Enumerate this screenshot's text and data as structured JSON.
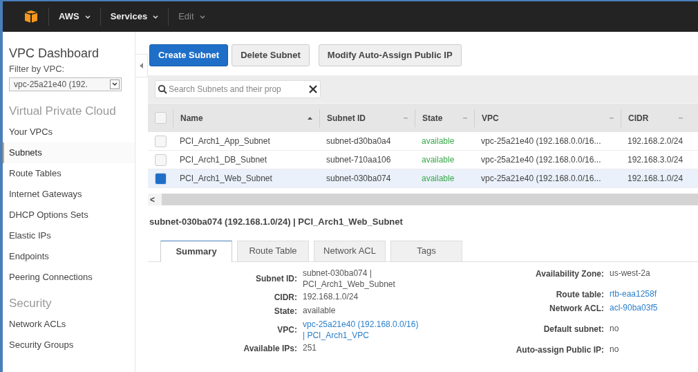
{
  "top_nav": [
    {
      "label": "AWS",
      "muted": false
    },
    {
      "label": "Services",
      "muted": false
    },
    {
      "label": "Edit",
      "muted": true
    }
  ],
  "sidebar": {
    "title": "VPC Dashboard",
    "filter_label": "Filter by VPC:",
    "filter_value": "vpc-25a21e40 (192.",
    "items": [
      {
        "kind": "section",
        "label": "Virtual Private Cloud"
      },
      {
        "kind": "link",
        "label": "Your VPCs",
        "selected": false
      },
      {
        "kind": "link",
        "label": "Subnets",
        "selected": true
      },
      {
        "kind": "link",
        "label": "Route Tables",
        "selected": false
      },
      {
        "kind": "link",
        "label": "Internet Gateways",
        "selected": false
      },
      {
        "kind": "link",
        "label": "DHCP Options Sets",
        "selected": false
      },
      {
        "kind": "link",
        "label": "Elastic IPs",
        "selected": false
      },
      {
        "kind": "link",
        "label": "Endpoints",
        "selected": false
      },
      {
        "kind": "link",
        "label": "Peering Connections",
        "selected": false
      },
      {
        "kind": "section",
        "label": "Security"
      },
      {
        "kind": "link",
        "label": "Network ACLs",
        "selected": false
      },
      {
        "kind": "link",
        "label": "Security Groups",
        "selected": false
      }
    ]
  },
  "toolbar": [
    {
      "label": "Create Subnet",
      "primary": true
    },
    {
      "label": "Delete Subnet",
      "primary": false
    },
    {
      "label": "Modify Auto-Assign Public IP",
      "primary": false
    }
  ],
  "search": {
    "placeholder": "Search Subnets and their prop"
  },
  "table": {
    "select_all": {
      "checked": false
    },
    "columns": [
      {
        "label": "Name",
        "sorted": true
      },
      {
        "label": "Subnet ID",
        "sorted": false
      },
      {
        "label": "State",
        "sorted": false
      },
      {
        "label": "VPC",
        "sorted": false
      },
      {
        "label": "CIDR",
        "sorted": false
      }
    ],
    "rows": [
      {
        "selected": false,
        "cells": [
          "PCI_Arch1_App_Subnet",
          "subnet-d30ba0a4",
          "available",
          "vpc-25a21e40 (192.168.0.0/16...",
          "192.168.2.0/24"
        ]
      },
      {
        "selected": false,
        "cells": [
          "PCI_Arch1_DB_Subnet",
          "subnet-710aa106",
          "available",
          "vpc-25a21e40 (192.168.0.0/16...",
          "192.168.3.0/24"
        ]
      },
      {
        "selected": true,
        "cells": [
          "PCI_Arch1_Web_Subnet",
          "subnet-030ba074",
          "available",
          "vpc-25a21e40 (192.168.0.0/16...",
          "192.168.1.0/24"
        ]
      }
    ]
  },
  "scroll_left": "<",
  "detail": {
    "title": "subnet-030ba074 (192.168.1.0/24) | PCI_Arch1_Web_Subnet",
    "tabs": [
      {
        "label": "Summary",
        "selected": true
      },
      {
        "label": "Route Table",
        "selected": false
      },
      {
        "label": "Network ACL",
        "selected": false
      },
      {
        "label": "Tags",
        "selected": false
      }
    ],
    "left_fields": [
      {
        "label": "Subnet ID:",
        "lines": [
          "subnet-030ba074 |",
          "PCI_Arch1_Web_Subnet"
        ],
        "link": false
      },
      {
        "label": "CIDR:",
        "lines": [
          "192.168.1.0/24"
        ],
        "link": false
      },
      {
        "label": "State:",
        "lines": [
          "available"
        ],
        "link": false
      },
      {
        "label": "VPC:",
        "lines": [
          "vpc-25a21e40 (192.168.0.0/16)",
          "| PCI_Arch1_VPC"
        ],
        "link": true
      },
      {
        "label": "Available IPs:",
        "lines": [
          "251"
        ],
        "link": false
      }
    ],
    "right_fields": [
      {
        "label": "Availability Zone:",
        "lines": [
          "us-west-2a"
        ],
        "link": false
      },
      {
        "label": "Route table:",
        "lines": [
          "rtb-eaa1258f"
        ],
        "link": true
      },
      {
        "label": "Network ACL:",
        "lines": [
          "acl-90ba03f5"
        ],
        "link": true
      },
      {
        "label": "Default subnet:",
        "lines": [
          "no"
        ],
        "link": false
      },
      {
        "label": "Auto-assign Public IP:",
        "lines": [
          "no"
        ],
        "link": false
      }
    ]
  }
}
